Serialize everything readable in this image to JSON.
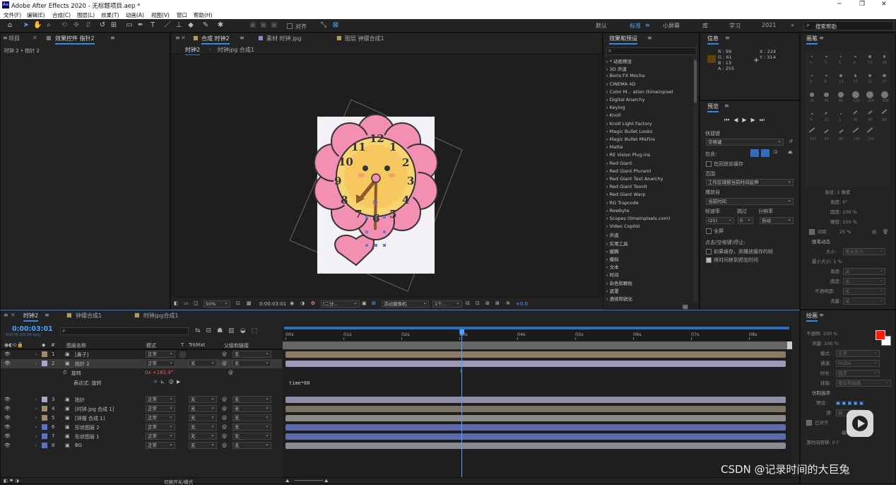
{
  "window": {
    "title": "Adobe After Effects 2020 - 无标题项目.aep *",
    "logo": "Ae",
    "minimize": "─",
    "restore": "❐",
    "close": "✕"
  },
  "menu": [
    "文件(F)",
    "编辑(E)",
    "合成(C)",
    "图层(L)",
    "效果(T)",
    "动画(A)",
    "视图(V)",
    "窗口",
    "帮助(H)"
  ],
  "toolbar": {
    "align_label": "对齐",
    "workspaces": [
      "默认",
      "标准",
      "小屏幕",
      "库",
      "学习",
      "2021"
    ],
    "active_workspace": "标准",
    "search_placeholder": "搜索帮助"
  },
  "project_panel": {
    "tab_project": "项目",
    "tab_effects": "效果控件 指针2",
    "breadcrumb": "时钟 2 • 指针 2"
  },
  "comp_panel": {
    "tabs": [
      "合成 时钟2",
      "素材 时钟.jpg",
      "图层 钟摆合成1"
    ],
    "subtabs": [
      "时钟2",
      "时钟jpg 合成1"
    ],
    "zoom": "50%",
    "timecode": "0:00:03:01",
    "resolution": "(二分...",
    "camera": "活动摄像机",
    "views": "1个...",
    "exposure": "+0.0"
  },
  "clock": {
    "numbers": [
      "12",
      "1",
      "2",
      "3",
      "4",
      "5",
      "6",
      "7",
      "8",
      "9",
      "10",
      "11"
    ]
  },
  "effects_panel": {
    "title": "效果和预设",
    "items": [
      "* 动画预设",
      "3D 声道",
      "Boris FX Mocha",
      "CINEMA 4D",
      "Color M... ation (timeinpixel",
      "Digital Anarchy",
      "Keying",
      "Knoll",
      "Knoll Light Factory",
      "Magic Bullet Looks",
      "Magic Bullet MisFire",
      "Matte",
      "RE Vision Plug-ins",
      "Red Giant",
      "Red Giant Pluraml",
      "Red Giant Text Anarchy",
      "Red Giant Toonlt",
      "Red Giant Warp",
      "RG Trapcode",
      "Rowbyte",
      "Scopes (timeinpixels.com)",
      "Video Copilot",
      "声道",
      "实用工具",
      "模糊",
      "模拟",
      "文本",
      "时间",
      "杂色和颗粒",
      "遮罩",
      "透视和锐化"
    ]
  },
  "info_panel": {
    "title": "信息",
    "r": "R : 99",
    "g": "G : 61",
    "b": "B : 13",
    "a": "A : 255",
    "x": "X : 224",
    "y": "Y : 314",
    "swatch": "#63410d"
  },
  "preview_panel": {
    "title": "预览",
    "shortcut_label": "快捷键",
    "shortcut_value": "空格键",
    "include_label": "包含:",
    "cache_label": "在回放前缓存",
    "range_label": "范围",
    "range_value": "工作区域按当前时间延伸",
    "play_from_label": "播放自",
    "play_from_value": "当前时间",
    "fps_label": "帧速率",
    "skip_label": "跳过",
    "res_label": "分辨率",
    "fps_value": "(25)",
    "skip_value": "0",
    "res_value": "自动",
    "fullscreen_label": "全屏",
    "stop_label": "点击(空格键)停止:",
    "stop_opt1": "如果缓存，则播放缓存的帧",
    "stop_opt2": "将时间移到预览时间"
  },
  "brushes_panel": {
    "title": "画笔",
    "sizes": [
      "1",
      "3",
      "5",
      "9",
      "13",
      "19",
      "5",
      "9",
      "13",
      "17",
      "21",
      "27",
      "35",
      "45",
      "65",
      "100",
      "200",
      "300",
      "9",
      "21",
      "1",
      "45",
      "45",
      "65",
      "131",
      "45",
      "45",
      "131",
      "131"
    ]
  },
  "brush_props": {
    "diameter": "直径: 1 像素",
    "angle": "角度: 0°",
    "roundness": "圆度: 100 %",
    "hardness": "硬度: 100 %",
    "spacing_label": "间距",
    "spacing_value": "25 %",
    "dynamics": "画笔动态",
    "size": "大小:",
    "size_val": "笔头压力",
    "min_size": "最小大小: 1 %",
    "angle2": "角度:",
    "angle2_val": "关",
    "roundness2": "圆度:",
    "roundness2_val": "关",
    "opacity": "不透明度:",
    "opacity_val": "关",
    "flow": "流量:",
    "flow_val": "关"
  },
  "paint_panel": {
    "title": "绘画",
    "opacity": "不透明: 100 %",
    "flow": "流量: 100 %",
    "mode_label": "模式:",
    "mode_value": "正常",
    "channel_label": "通道:",
    "channel_value": "RGBA",
    "duration_label": "时长:",
    "duration_value": "固定",
    "erase_label": "抹除:",
    "erase_value": "图层和绘画",
    "clone_label": "仿制选项",
    "preset_label": "预设:",
    "source_label": "源:",
    "source_value": "自",
    "aligned_label": "已对齐",
    "offset_label": "偏移:",
    "source_time_label": "源时间转移:",
    "source_time_value": "0 f",
    "fg": "#ff1a0a",
    "bg": "#ffffff"
  },
  "timeline": {
    "tabs": [
      "时钟2",
      "钟摆合成1",
      "时钟jpg合成1"
    ],
    "timecode": "0:00:03:01",
    "timecode_sub": "00076 (25.00 fps)",
    "col_name": "图层名称",
    "col_mode": "模式",
    "col_t": "T",
    "col_trk": "TrkMat",
    "col_parent": "父级和链接",
    "ruler": [
      "00s",
      "01s",
      "02s",
      "03s",
      "04s",
      "05s",
      "06s",
      "07s",
      "08s"
    ],
    "playhead_fraction": 0.336,
    "layers": [
      {
        "num": "1",
        "name": "[鼻子]",
        "mode": "正常",
        "trk": "",
        "parent": "无",
        "color": "#a48a68",
        "bar": "#8b7b66"
      },
      {
        "num": "2",
        "name": "指针 2",
        "mode": "正常",
        "trk": "无",
        "parent": "无",
        "color": "#a7a7c8",
        "bar": "#9a9ab8"
      },
      {
        "num": "3",
        "name": "指针",
        "mode": "正常",
        "trk": "无",
        "parent": "无",
        "color": "#a7a7c8",
        "bar": "#8e8ea8"
      },
      {
        "num": "4",
        "name": "[时钟.jpg 合成 1]",
        "mode": "正常",
        "trk": "无",
        "parent": "无",
        "color": "#a48a68",
        "bar": "#7d7260"
      },
      {
        "num": "5",
        "name": "[钟摆 合成 1]",
        "mode": "正常",
        "trk": "无",
        "parent": "无",
        "color": "#a48a68",
        "bar": "#8c8a86"
      },
      {
        "num": "6",
        "name": "形状图层 2",
        "mode": "正常",
        "trk": "无",
        "parent": "无",
        "color": "#5b6fcf",
        "bar": "#5a6aab"
      },
      {
        "num": "7",
        "name": "形状图层 1",
        "mode": "正常",
        "trk": "无",
        "parent": "无",
        "color": "#5b6fcf",
        "bar": "#5a6aab"
      },
      {
        "num": "8",
        "name": "BG",
        "mode": "正常",
        "trk": "无",
        "parent": "无",
        "color": "#5b6fcf",
        "bar": "#8a8a94"
      }
    ],
    "rotation_label": "旋转",
    "rotation_value": "0x +182.4°",
    "expr_label": "表达式: 旋转",
    "expr_text": "time*60",
    "footer_toggle": "切换开关/模式"
  },
  "watermark": "CSDN @记录时间的大巨兔"
}
